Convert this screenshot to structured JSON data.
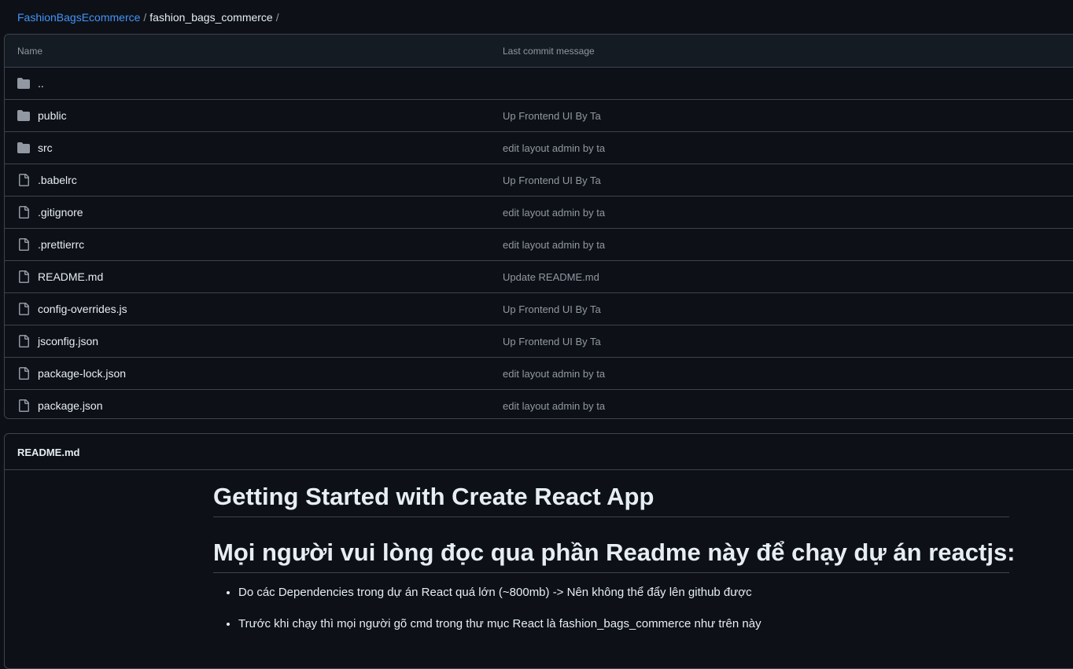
{
  "breadcrumb": {
    "owner": "FashionBagsEcommerce",
    "separator": "/",
    "repo": "fashion_bags_commerce",
    "trailing": "/"
  },
  "table": {
    "col_name": "Name",
    "col_commit": "Last commit message"
  },
  "parent_dir": "..",
  "files": [
    {
      "name": "public",
      "type": "folder",
      "message": "Up Frontend UI By Ta"
    },
    {
      "name": "src",
      "type": "folder",
      "message": "edit layout admin by ta"
    },
    {
      "name": ".babelrc",
      "type": "file",
      "message": "Up Frontend UI By Ta"
    },
    {
      "name": ".gitignore",
      "type": "file",
      "message": "edit layout admin by ta"
    },
    {
      "name": ".prettierrc",
      "type": "file",
      "message": "edit layout admin by ta"
    },
    {
      "name": "README.md",
      "type": "file",
      "message": "Update README.md"
    },
    {
      "name": "config-overrides.js",
      "type": "file",
      "message": "Up Frontend UI By Ta"
    },
    {
      "name": "jsconfig.json",
      "type": "file",
      "message": "Up Frontend UI By Ta"
    },
    {
      "name": "package-lock.json",
      "type": "file",
      "message": "edit layout admin by ta"
    },
    {
      "name": "package.json",
      "type": "file",
      "message": "edit layout admin by ta"
    }
  ],
  "readme": {
    "title": "README.md",
    "h1": "Getting Started with Create React App",
    "h2": "Mọi người vui lòng đọc qua phần Readme này để chạy dự án reactjs:",
    "bullets": [
      "Do các Dependencies trong dự án React quá lớn (~800mb) -> Nên không thể đẩy lên github được",
      "Trước khi chạy thì mọi người gõ cmd trong thư mục React là fashion_bags_commerce như trên này"
    ]
  },
  "colors": {
    "background": "#0d1117",
    "link": "#4493f8",
    "muted": "#9198a1",
    "border": "#3d444d"
  }
}
